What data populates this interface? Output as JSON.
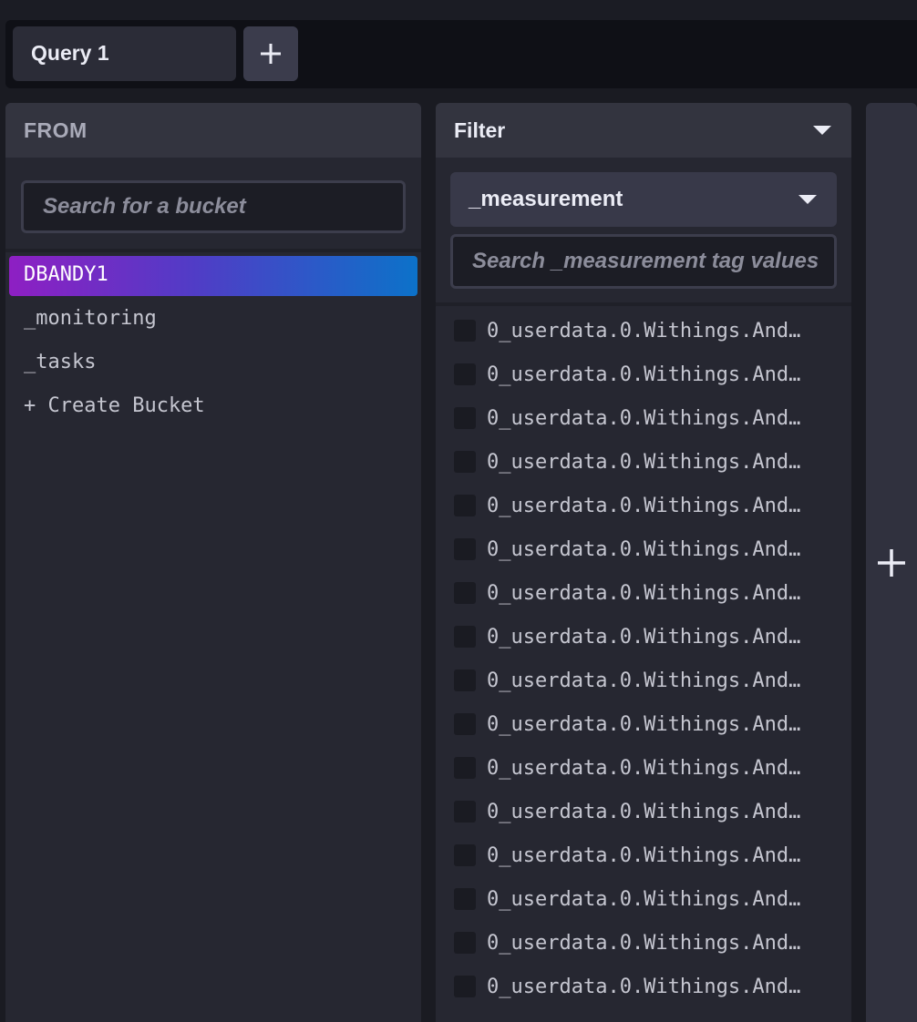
{
  "query_tabs": [
    {
      "label": "Query 1",
      "active": true
    }
  ],
  "add_query_icon": "plus-icon",
  "from_panel": {
    "title": "FROM",
    "search_placeholder": "Search for a bucket",
    "buckets": [
      {
        "label": "DBANDY1",
        "selected": true
      },
      {
        "label": "_monitoring",
        "selected": false
      },
      {
        "label": "_tasks",
        "selected": false
      }
    ],
    "create_bucket_label": "+ Create Bucket",
    "selected_gradient": [
      "#8e1fc3",
      "#0c72c9"
    ]
  },
  "filter_panel": {
    "title": "Filter",
    "title_icon": "caret-down-icon",
    "key_selected": "_measurement",
    "key_icon": "caret-down-icon",
    "search_placeholder": "Search _measurement tag values",
    "values": [
      "0_userdata.0.Withings.And…",
      "0_userdata.0.Withings.And…",
      "0_userdata.0.Withings.And…",
      "0_userdata.0.Withings.And…",
      "0_userdata.0.Withings.And…",
      "0_userdata.0.Withings.And…",
      "0_userdata.0.Withings.And…",
      "0_userdata.0.Withings.And…",
      "0_userdata.0.Withings.And…",
      "0_userdata.0.Withings.And…",
      "0_userdata.0.Withings.And…",
      "0_userdata.0.Withings.And…",
      "0_userdata.0.Withings.And…",
      "0_userdata.0.Withings.And…",
      "0_userdata.0.Withings.And…",
      "0_userdata.0.Withings.And…"
    ]
  },
  "add_filter_icon": "plus-icon"
}
